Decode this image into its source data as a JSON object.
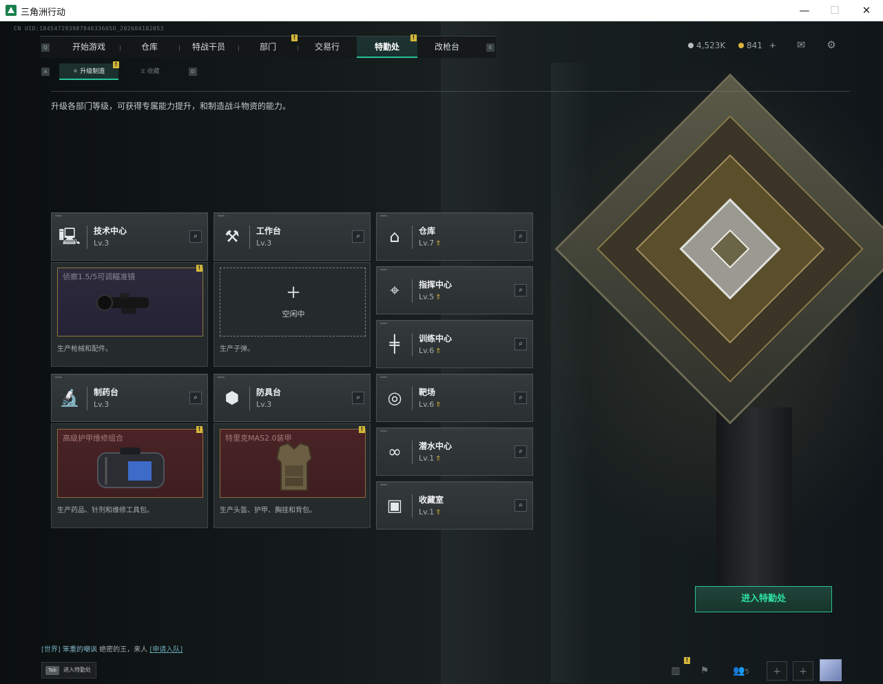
{
  "window": {
    "title": "三角洲行动",
    "minimize": "—",
    "maximize": "☐",
    "close": "✕"
  },
  "uid": "CN UID:18454729398784633605O_202604182053",
  "nav": {
    "key_left": "Q",
    "key_right": "E",
    "tabs": [
      {
        "label": "开始游戏"
      },
      {
        "label": "仓库"
      },
      {
        "label": "特战干员"
      },
      {
        "label": "部门",
        "badge": "!"
      },
      {
        "label": "交易行"
      },
      {
        "label": "特勤处",
        "badge": "!",
        "active": true
      },
      {
        "label": "改枪台"
      }
    ]
  },
  "currency": {
    "coins": "4,523K",
    "coupons": "841",
    "add": "+"
  },
  "header_icons": [
    "mail-icon",
    "gear-icon"
  ],
  "subnav": {
    "key_left": "A",
    "key_right": "D",
    "tabs": [
      {
        "label": "升级制造",
        "badge": "!",
        "active": true
      },
      {
        "label": "收藏"
      }
    ]
  },
  "description": "升级各部门等级，可获得专属能力提升，和制造战斗物资的能力。",
  "facilities": [
    {
      "name": "技术中心",
      "level": "Lv.3",
      "icon": "monitor-icon",
      "upgradable": false
    },
    {
      "name": "工作台",
      "level": "Lv.3",
      "icon": "tools-icon",
      "upgradable": false
    },
    {
      "name": "仓库",
      "level": "Lv.7",
      "icon": "warehouse-icon",
      "upgradable": true
    },
    {
      "name": "指挥中心",
      "level": "Lv.5",
      "icon": "command-icon",
      "upgradable": true
    },
    {
      "name": "训练中心",
      "level": "Lv.6",
      "icon": "dumbbell-icon",
      "upgradable": true
    },
    {
      "name": "制药台",
      "level": "Lv.3",
      "icon": "microscope-icon",
      "upgradable": false
    },
    {
      "name": "防具台",
      "level": "Lv.3",
      "icon": "armor-blocks-icon",
      "upgradable": false
    },
    {
      "name": "靶场",
      "level": "Lv.6",
      "icon": "target-icon",
      "upgradable": true
    },
    {
      "name": "潜水中心",
      "level": "Lv.1",
      "icon": "diving-mask-icon",
      "upgradable": true
    },
    {
      "name": "收藏室",
      "level": "Lv.1",
      "icon": "collection-icon",
      "upgradable": true
    }
  ],
  "up_arrow": "⇑",
  "search_glyph": "⌕",
  "production": [
    {
      "item": "侦察1.5/5可调瞄准镜",
      "caption": "生产枪械和配件。",
      "badge": "!",
      "style": "scope"
    },
    {
      "item": "",
      "idle_label": "空闲中",
      "plus": "+",
      "caption": "生产子弹。",
      "style": "empty"
    },
    {
      "item": "高级护甲维修组合",
      "caption": "生产药品、针剂和维修工具包。",
      "badge": "!",
      "style": "red"
    },
    {
      "item": "特里克MAS2.0装甲",
      "caption": "生产头盔、护甲、胸挂和背包。",
      "badge": "!",
      "style": "red"
    }
  ],
  "enter_button": "进入特勤处",
  "chat": {
    "channel": "[世界]",
    "user": "笨重的嘲讽",
    "message": "绝密的王，来人",
    "action": "[申请入队]"
  },
  "tab_hint": {
    "key": "Tab",
    "label": "进入特勤处"
  },
  "bottom_bar": {
    "friends_count": "5",
    "badge": "!"
  },
  "colors": {
    "accent": "#27c59a",
    "badge": "#d4b73a",
    "enter": "#2ee2a4"
  }
}
